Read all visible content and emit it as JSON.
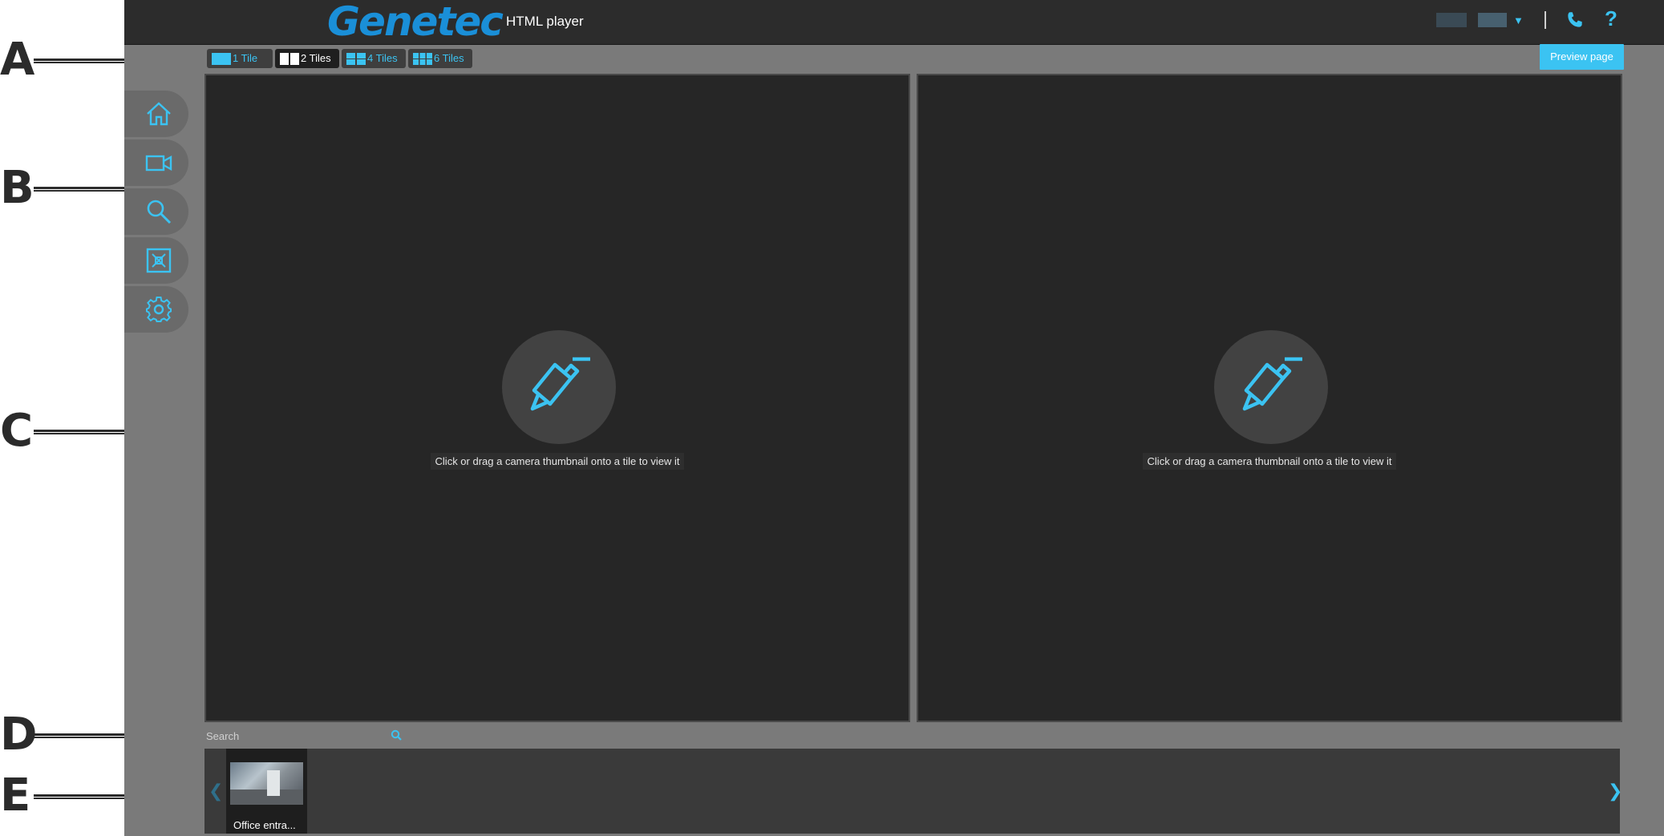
{
  "callouts": [
    "A",
    "B",
    "C",
    "D",
    "E"
  ],
  "header": {
    "logo": "Genetec",
    "app_title": "HTML player",
    "help": "?"
  },
  "toolbar": {
    "tile_buttons": [
      {
        "label": "1 Tile",
        "active": false
      },
      {
        "label": "2 Tiles",
        "active": true
      },
      {
        "label": "4 Tiles",
        "active": false
      },
      {
        "label": "6 Tiles",
        "active": false
      }
    ],
    "preview_label": "Preview page"
  },
  "sidebar": {
    "items": [
      {
        "icon": "home-icon"
      },
      {
        "icon": "camera-icon"
      },
      {
        "icon": "search-icon"
      },
      {
        "icon": "fullscreen-icon"
      },
      {
        "icon": "gear-icon"
      }
    ]
  },
  "tiles": [
    {
      "hint": "Click or drag a camera thumbnail onto a tile to view it"
    },
    {
      "hint": "Click or drag a camera thumbnail onto a tile to view it"
    }
  ],
  "search": {
    "placeholder": "Search"
  },
  "thumbnails": [
    {
      "label": "Office entra..."
    }
  ],
  "colors": {
    "accent": "#3bc3f2",
    "header_bg": "#2c2c2c",
    "tile_bg": "#262626",
    "app_bg": "#7a7a7a"
  }
}
